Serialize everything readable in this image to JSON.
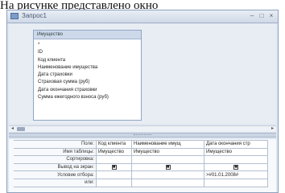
{
  "caption": "На рисунке представлено окно",
  "window": {
    "title": "Запрос1",
    "buttons": {
      "minimize": "–",
      "maximize": "□",
      "close": "×"
    }
  },
  "table_box": {
    "title": "Имущество",
    "fields": [
      "*",
      "ID",
      "Код клиента",
      "Наименование имущества",
      "Дата страховки",
      "Страховая сумма (руб)",
      "Дата окончания страховки",
      "Сумма ежегодного взноса (руб)"
    ]
  },
  "grid": {
    "row_labels": [
      "Поле:",
      "Имя таблицы:",
      "Сортировка:",
      "Вывод на экран:",
      "Условие отбора:",
      "или:"
    ],
    "columns": [
      {
        "field": "Код клиента",
        "table": "Имущество",
        "sort": "",
        "show": true,
        "criteria": "",
        "or": ""
      },
      {
        "field": "Наименование имущ",
        "table": "Имущество",
        "sort": "",
        "show": true,
        "criteria": "",
        "or": ""
      },
      {
        "field": "Дата окончания стр",
        "table": "Имущество",
        "sort": "",
        "show": true,
        "criteria": ">#01.01.2008#",
        "or": ""
      }
    ]
  }
}
